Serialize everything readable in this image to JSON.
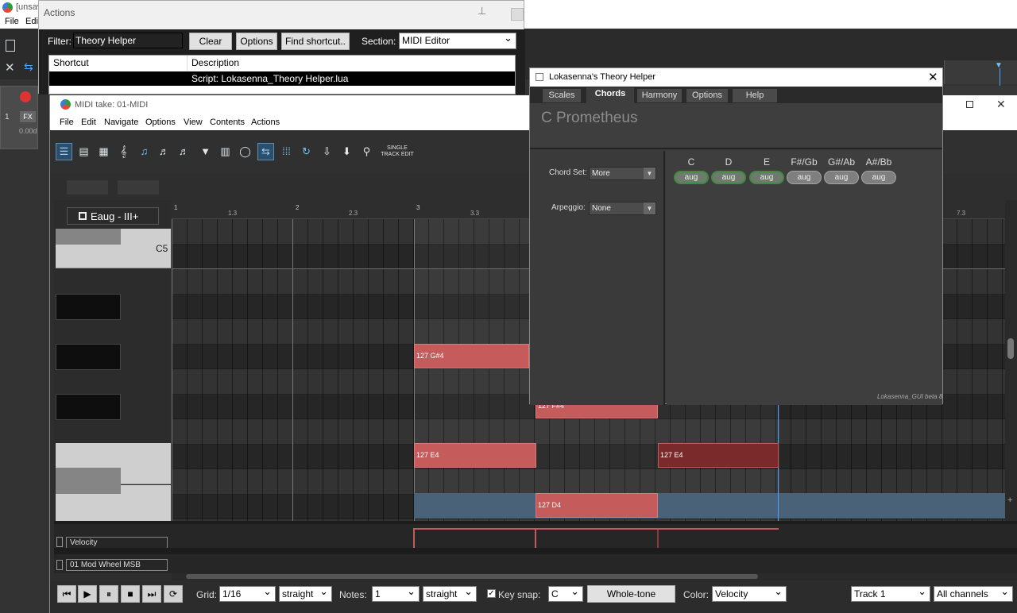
{
  "reaper": {
    "title": "[unsav",
    "menu": [
      "File",
      "Edi"
    ],
    "fx": "FX",
    "track_num": "1",
    "db": "0.00d"
  },
  "actions": {
    "title": "Actions",
    "filter_label": "Filter:",
    "filter_value": "Theory Helper",
    "buttons": {
      "clear": "Clear",
      "options": "Options",
      "find": "Find shortcut.."
    },
    "section_label": "Section:",
    "section_value": "MIDI Editor",
    "columns": {
      "shortcut": "Shortcut",
      "description": "Description"
    },
    "row": {
      "shortcut": "",
      "description": "Script: Lokasenna_Theory Helper.lua"
    }
  },
  "midi": {
    "title": "MIDI take: 01-MIDI",
    "menu": [
      "File",
      "Edit",
      "Navigate",
      "Options",
      "View",
      "Contents",
      "Actions"
    ],
    "single_track_edit": [
      "SINGLE",
      "TRACK EDIT"
    ],
    "chord_label": "Eaug - III+",
    "c5": "C5",
    "ruler": {
      "major": [
        "1",
        "2",
        "3"
      ],
      "minor": [
        "1.3",
        "2.3",
        "3.3"
      ],
      "far": "7.3"
    },
    "notes": [
      {
        "label": "127 G#4",
        "pitch": "G#4",
        "velocity": 127
      },
      {
        "label": "127 F#4",
        "pitch": "F#4",
        "velocity": 127
      },
      {
        "label": "127 E4",
        "pitch": "E4",
        "velocity": 127
      },
      {
        "label": "127 E4",
        "pitch": "E4",
        "velocity": 127
      },
      {
        "label": "127 D4",
        "pitch": "D4",
        "velocity": 127
      }
    ],
    "lanes": [
      "Velocity",
      "01 Mod Wheel MSB"
    ],
    "bottom": {
      "grid_label": "Grid:",
      "grid_value": "1/16",
      "grid_mode": "straight",
      "notes_label": "Notes:",
      "notes_value": "1",
      "notes_mode": "straight",
      "keysnap_label": "Key snap:",
      "key_value": "C",
      "scale_button": "Whole-tone",
      "color_label": "Color:",
      "color_value": "Velocity",
      "track_value": "Track 1",
      "channels_value": "All channels"
    }
  },
  "theory": {
    "title": "Lokasenna's Theory Helper",
    "tabs": [
      "Scales",
      "Chords",
      "Harmony",
      "Options",
      "Help"
    ],
    "active_tab": "Chords",
    "scale_name": "C Prometheus",
    "chord_set_label": "Chord Set:",
    "chord_set_value": "More",
    "arpeggio_label": "Arpeggio:",
    "arpeggio_value": "None",
    "roots": [
      "C",
      "D",
      "E",
      "F#/Gb",
      "G#/Ab",
      "A#/Bb"
    ],
    "chord": "aug",
    "footer": "Lokasenna_GUI beta 8"
  },
  "colors": {
    "note": "#c65b5b",
    "note_dark": "#7a2a2a",
    "accent": "#5b8db5",
    "highlight_row": "#4a6278"
  }
}
